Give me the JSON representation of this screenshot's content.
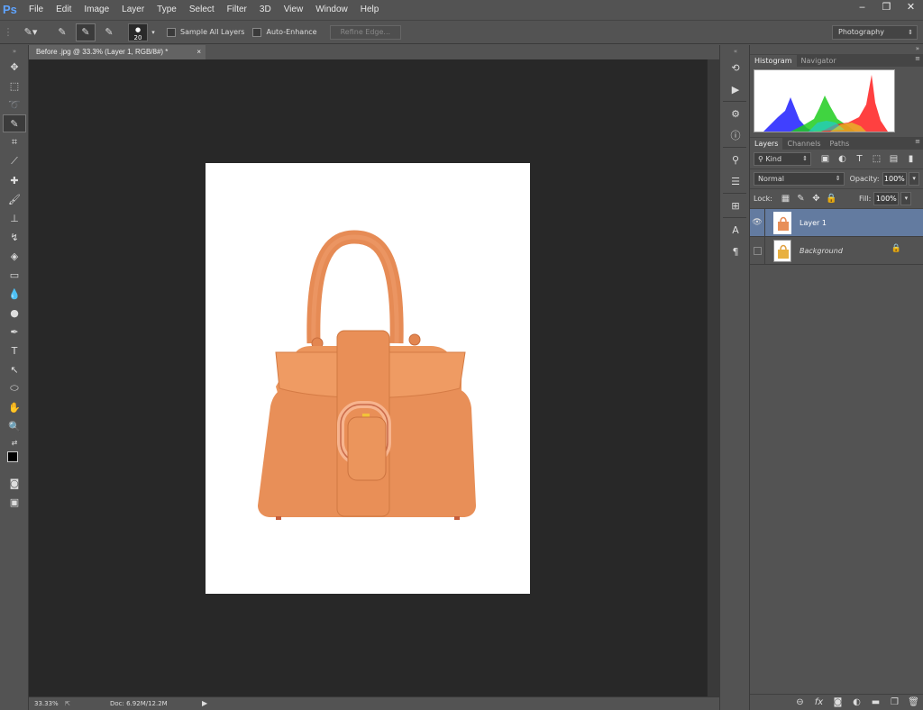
{
  "app": {
    "logo": "Ps"
  },
  "menu": [
    "File",
    "Edit",
    "Image",
    "Layer",
    "Type",
    "Select",
    "Filter",
    "3D",
    "View",
    "Window",
    "Help"
  ],
  "window_controls": [
    "‒",
    "❐",
    "✕"
  ],
  "options": {
    "brush_size": "20",
    "sample_all_layers": "Sample All Layers",
    "auto_enhance": "Auto-Enhance",
    "refine_edge": "Refine Edge...",
    "workspace": "Photography"
  },
  "document": {
    "tab_title": "Before .jpg @ 33.3% (Layer 1, RGB/8#) *",
    "close": "×"
  },
  "status": {
    "zoom": "33.33%",
    "doc_size": "Doc: 6.92M/12.2M",
    "arrow": "▶"
  },
  "panels": {
    "histogram_tabs": [
      "Histogram",
      "Navigator"
    ],
    "layers_tabs": [
      "Layers",
      "Channels",
      "Paths"
    ],
    "kind": "Kind",
    "blend_mode": "Normal",
    "opacity_label": "Opacity:",
    "opacity_value": "100%",
    "lock_label": "Lock:",
    "fill_label": "Fill:",
    "fill_value": "100%"
  },
  "layers": [
    {
      "name": "Layer 1",
      "selected": true,
      "visible": true
    },
    {
      "name": "Background",
      "selected": false,
      "visible": false,
      "locked": true
    }
  ],
  "histogram": {
    "channels": [
      {
        "color": "#1f1fff"
      },
      {
        "color": "#1fcc1f"
      },
      {
        "color": "#ff1f1f"
      }
    ]
  },
  "footer_icons": [
    "link-icon",
    "fx-icon",
    "mask-icon",
    "adjustment-icon",
    "group-icon",
    "new-layer-icon",
    "trash-icon"
  ],
  "colors": {
    "accent_selected": "#637ba0",
    "canvas_bg": "#282828",
    "bag": "#e8905a"
  }
}
